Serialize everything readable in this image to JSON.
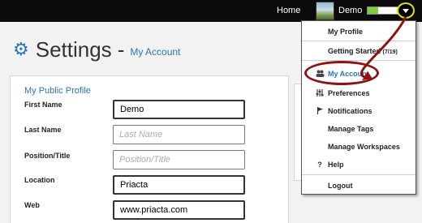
{
  "topbar": {
    "home_label": "Home",
    "user_name": "Demo",
    "status_fill_fraction": 0.35,
    "status_color": "#7bd038",
    "dropdown_icon": "chevron-down-icon"
  },
  "header": {
    "icon": "gear-icon",
    "title": "Settings",
    "separator": "-",
    "subtitle": "My Account"
  },
  "profile": {
    "section_title": "My Public Profile",
    "fields": [
      {
        "label": "First Name",
        "value": "Demo",
        "placeholder": ""
      },
      {
        "label": "Last Name",
        "value": "",
        "placeholder": "Last Name"
      },
      {
        "label": "Position/Title",
        "value": "",
        "placeholder": "Position/Title"
      },
      {
        "label": "Location",
        "value": "Priacta",
        "placeholder": ""
      },
      {
        "label": "Web",
        "value": "www.priacta.com",
        "placeholder": ""
      }
    ]
  },
  "menu": {
    "items": [
      {
        "label": "My Profile",
        "icon": ""
      },
      {
        "label": "Getting Started",
        "badge": "(7/19)",
        "icon": ""
      },
      {
        "label": "My Account",
        "icon": "users-icon",
        "active": true
      },
      {
        "label": "Preferences",
        "icon": "sliders-icon"
      },
      {
        "label": "Notifications",
        "icon": "flag-icon"
      },
      {
        "label": "Manage Tags",
        "icon": ""
      },
      {
        "label": "Manage Workspaces",
        "icon": ""
      },
      {
        "label": "Help",
        "icon": "question-icon"
      },
      {
        "label": "Logout",
        "icon": ""
      }
    ]
  },
  "colors": {
    "accent": "#2a75b8",
    "highlight": "#8e1212",
    "toggle_ring": "#e0e000"
  }
}
